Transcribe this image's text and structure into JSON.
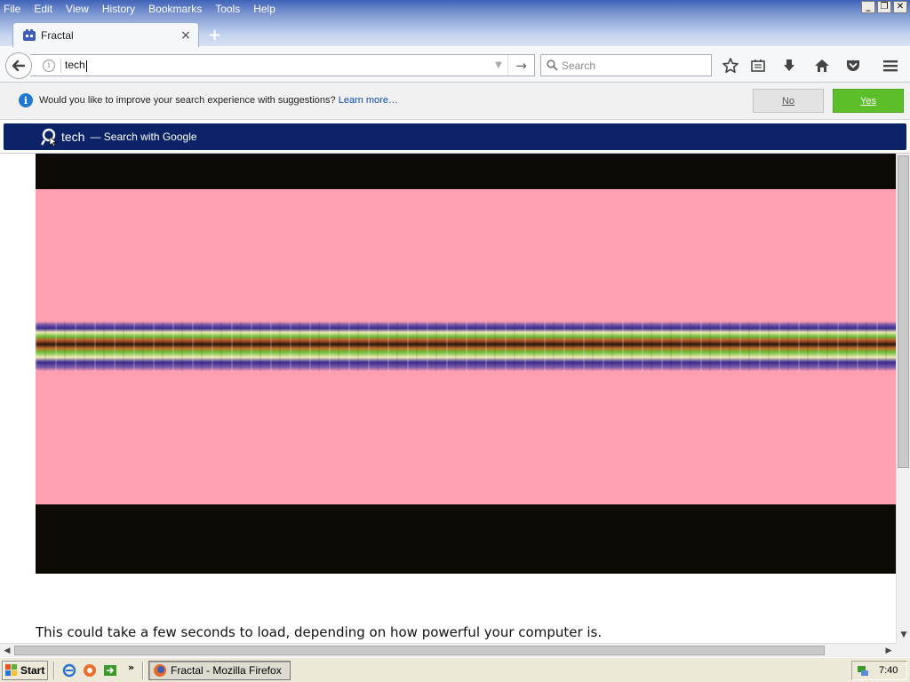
{
  "menubar": {
    "items": [
      {
        "label": "File"
      },
      {
        "label": "Edit"
      },
      {
        "label": "View"
      },
      {
        "label": "History"
      },
      {
        "label": "Bookmarks"
      },
      {
        "label": "Tools"
      },
      {
        "label": "Help"
      }
    ]
  },
  "window_controls": {
    "minimize": "_",
    "maximize": "❐",
    "close": "✕"
  },
  "tabs": [
    {
      "title": "Fractal",
      "favicon": "fractal-favicon-icon",
      "close_glyph": "×"
    }
  ],
  "new_tab_glyph": "+",
  "toolbar": {
    "url_value": "tech",
    "search_placeholder": "Search",
    "icons": [
      "back-arrow-icon",
      "site-info-icon",
      "dropdown-icon",
      "go-arrow-icon",
      "search-icon",
      "bookmark-star-icon",
      "reading-list-icon",
      "downloads-icon",
      "home-icon",
      "pocket-icon",
      "hamburger-menu-icon"
    ]
  },
  "notification": {
    "message": "Would you like to improve your search experience with suggestions?",
    "link": "Learn more…",
    "no_label": "No",
    "yes_label": "Yes",
    "yes_color": "#5cbf2a"
  },
  "autocomplete": {
    "query": "tech",
    "action": "— Search with Google",
    "highlight_color": "#0c2467"
  },
  "page": {
    "text": "This could take a few seconds to load, depending on how powerful your computer is.",
    "fractal_colors": {
      "background": "#0d0905",
      "pink": "#ff9fb1"
    }
  },
  "taskbar": {
    "start_label": "Start",
    "quicklaunch_more": "»",
    "task_label": "Fractal - Mozilla Firefox",
    "clock": "7:40"
  }
}
